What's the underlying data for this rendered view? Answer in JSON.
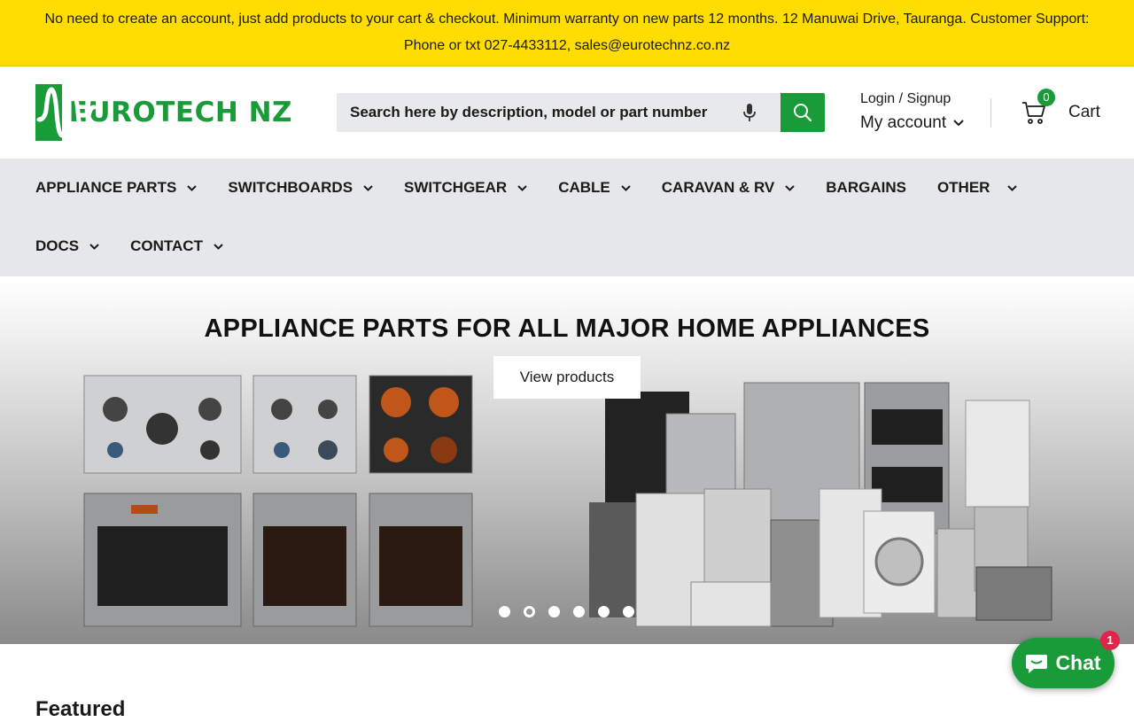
{
  "announcement": {
    "text": "No need to create an account, just add products to your cart & checkout. Minimum warranty on new parts 12 months. 12 Manuwai Drive, Tauranga. Customer Support: Phone or txt 027-4433112, sales@eurotechnz.co.nz"
  },
  "brand": {
    "name": "EUROTECH NZ",
    "color": "#1a9b3a"
  },
  "search": {
    "placeholder": "Search here by description, model or part number",
    "mic_icon": "microphone-icon",
    "button_icon": "search-icon"
  },
  "account": {
    "login_label": "Login / Signup",
    "my_account_label": "My account"
  },
  "cart": {
    "count": "0",
    "label": "Cart"
  },
  "nav": {
    "items": [
      {
        "label": "APPLIANCE PARTS",
        "dropdown": true
      },
      {
        "label": "SWITCHBOARDS",
        "dropdown": true
      },
      {
        "label": "SWITCHGEAR",
        "dropdown": true
      },
      {
        "label": "CABLE",
        "dropdown": true
      },
      {
        "label": "CARAVAN & RV",
        "dropdown": true
      },
      {
        "label": "BARGAINS",
        "dropdown": false
      },
      {
        "label": "OTHER",
        "dropdown": true
      },
      {
        "label": "DOCS",
        "dropdown": true
      },
      {
        "label": "CONTACT",
        "dropdown": true
      }
    ]
  },
  "hero": {
    "title": "APPLIANCE PARTS FOR ALL MAJOR HOME APPLIANCES",
    "button_label": "View products",
    "slide_count": 6,
    "active_slide": 2
  },
  "sections": {
    "featured_title": "Featured"
  },
  "chat": {
    "label": "Chat",
    "badge": "1",
    "color": "#1a9b3a",
    "badge_color": "#e0244a"
  },
  "colors": {
    "announcement_bg": "#ffdd00",
    "nav_bg": "#e6e7e9",
    "accent": "#1a9b3a"
  }
}
